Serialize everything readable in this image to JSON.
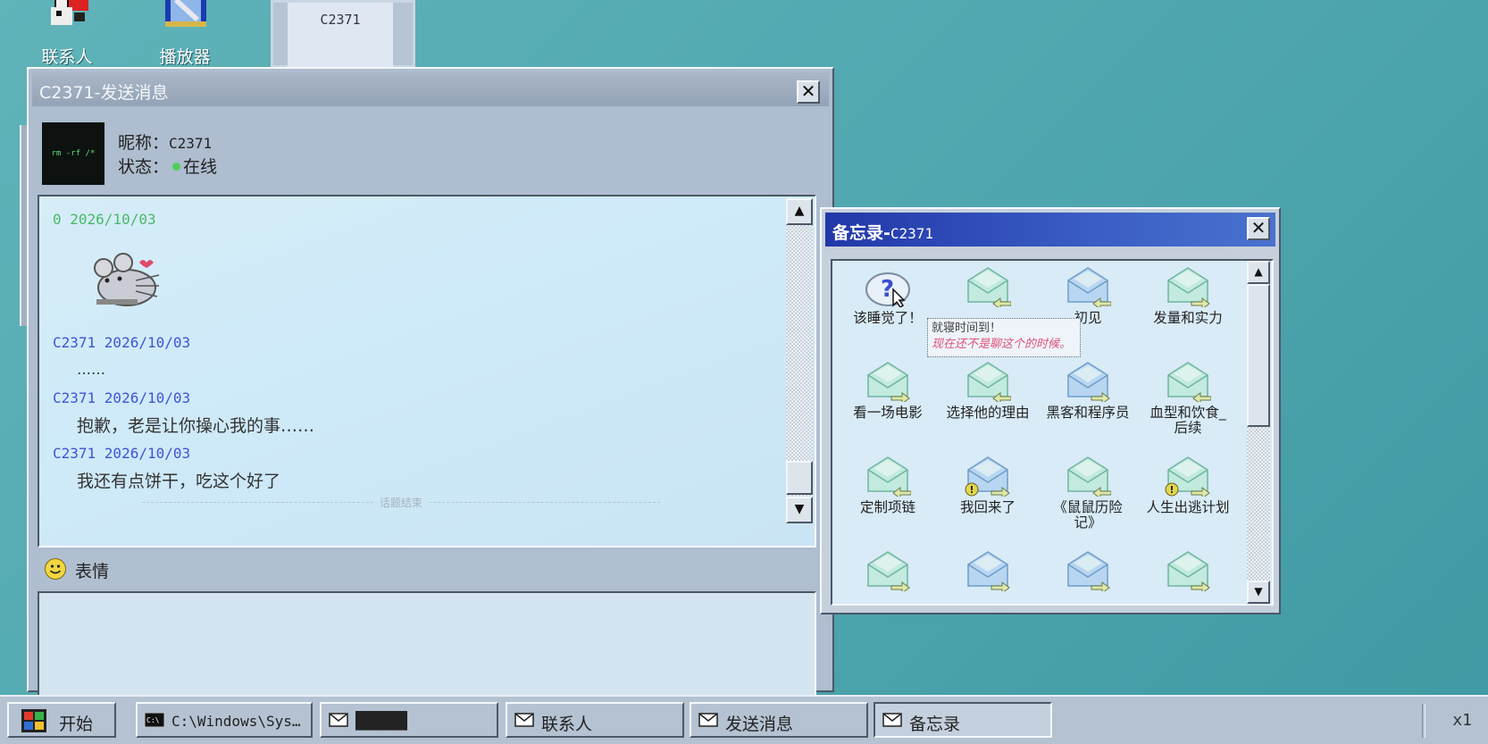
{
  "desktop": {
    "icons": [
      {
        "label": "联系人",
        "icon": "contacts-icon"
      },
      {
        "label": "播放器",
        "icon": "player-icon"
      }
    ],
    "mini_window_label": "C2371"
  },
  "chat_window": {
    "title": "C2371-发送消息",
    "avatar_text": "rm -rf /*",
    "nickname_label": "昵称：",
    "nickname": "C2371",
    "status_label": "状态：",
    "status": "在线",
    "messages": [
      {
        "header": "0 2026/10/03",
        "body": "",
        "sticker": "mouse-sticker"
      },
      {
        "header": "C2371 2026/10/03",
        "body": "……"
      },
      {
        "header": "C2371 2026/10/03",
        "body": "抱歉，老是让你操心我的事……"
      },
      {
        "header": "C2371 2026/10/03",
        "body": "我还有点饼干，吃这个好了"
      }
    ],
    "end_marker": "话题结束",
    "emoji_label": "表情",
    "input_value": ""
  },
  "memo_window": {
    "title_prefix": "备忘录-",
    "title_name": "C2371",
    "items": [
      {
        "label": "该睡觉了！",
        "icon": "question-icon",
        "arrow": "none",
        "alert": false
      },
      {
        "label": "",
        "icon": "envelope-icon",
        "arrow": "left",
        "alert": false
      },
      {
        "label": "初见",
        "icon": "envelope-icon",
        "arrow": "left",
        "alert": false
      },
      {
        "label": "发量和实力",
        "icon": "envelope-icon",
        "arrow": "right",
        "alert": false
      },
      {
        "label": "看一场电影",
        "icon": "envelope-icon",
        "arrow": "right",
        "alert": false
      },
      {
        "label": "选择他的理由",
        "icon": "envelope-icon",
        "arrow": "left",
        "alert": false
      },
      {
        "label": "黑客和程序员",
        "icon": "envelope-icon",
        "arrow": "right",
        "alert": false
      },
      {
        "label": "血型和饮食_后续",
        "icon": "envelope-icon",
        "arrow": "left",
        "alert": false
      },
      {
        "label": "定制项链",
        "icon": "envelope-icon",
        "arrow": "left",
        "alert": false
      },
      {
        "label": "我回来了",
        "icon": "envelope-icon",
        "arrow": "right",
        "alert": true
      },
      {
        "label": "《鼠鼠历险记》",
        "icon": "envelope-icon",
        "arrow": "left",
        "alert": false
      },
      {
        "label": "人生出逃计划",
        "icon": "envelope-icon",
        "arrow": "right",
        "alert": true
      },
      {
        "label": "",
        "icon": "envelope-icon",
        "arrow": "right",
        "alert": false
      },
      {
        "label": "",
        "icon": "envelope-icon",
        "arrow": "right",
        "alert": false
      },
      {
        "label": "",
        "icon": "envelope-icon",
        "arrow": "right",
        "alert": false
      },
      {
        "label": "",
        "icon": "envelope-icon",
        "arrow": "right",
        "alert": false
      }
    ],
    "tooltip": {
      "line1": "就寝时间到！",
      "line2": "现在还不是聊这个的时候。"
    }
  },
  "taskbar": {
    "start_label": "开始",
    "items": [
      {
        "label": "C:\\Windows\\Sys…",
        "icon": "cmd-icon"
      },
      {
        "label": "████",
        "icon": "mail-icon"
      },
      {
        "label": "联系人",
        "icon": "mail-icon"
      },
      {
        "label": "发送消息",
        "icon": "mail-icon"
      },
      {
        "label": "备忘录",
        "icon": "mail-icon"
      }
    ],
    "speed": "x1"
  },
  "colors": {
    "desktop": "#4fa6ae",
    "memo_title": "#2237a8",
    "online_dot": "#4fcf5a",
    "date_green": "#49b867",
    "date_blue": "#3b55d6"
  }
}
